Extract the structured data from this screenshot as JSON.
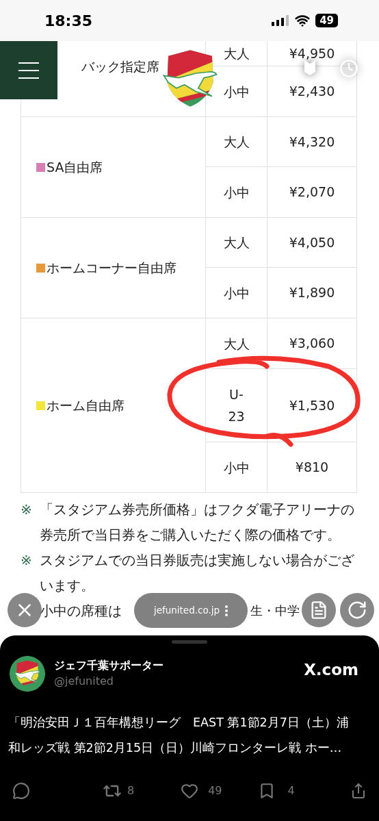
{
  "status_bar": {
    "time": "18:35",
    "battery": "49"
  },
  "price_table": {
    "sections": [
      {
        "label": "バック指定席",
        "rows": [
          {
            "type": "大人",
            "price": "¥4,950"
          },
          {
            "type": "小中",
            "price": "¥2,430"
          }
        ]
      },
      {
        "label": "SA自由席",
        "color": "#d77fb4",
        "rows": [
          {
            "type": "大人",
            "price": "¥4,320"
          },
          {
            "type": "小中",
            "price": "¥2,070"
          }
        ]
      },
      {
        "label": "ホームコーナー自由席",
        "color": "#e89a3a",
        "rows": [
          {
            "type": "大人",
            "price": "¥4,050"
          },
          {
            "type": "小中",
            "price": "¥1,890"
          }
        ]
      },
      {
        "label": "ホーム自由席",
        "color": "#f2e63c",
        "rows": [
          {
            "type": "大人",
            "price": "¥3,060"
          },
          {
            "type": "U-23",
            "price": "¥1,530"
          },
          {
            "type": "小中",
            "price": "¥810"
          }
        ]
      }
    ]
  },
  "notes": [
    {
      "mark": "※",
      "text": "「スタジアム券売所価格」はフクダ電子アリーナの券売所で当日券をご購入いただく際の価格です。"
    },
    {
      "mark": "※",
      "text": "スタジアムでの当日券販売は実施しない場合がございます。"
    },
    {
      "parts": [
        "小中の席種は",
        "生・中学"
      ]
    }
  ],
  "browser_bar": {
    "url": "jefunited.co.jp"
  },
  "post": {
    "author": "ジェフ千葉サポーター",
    "handle": "@jefunited",
    "source": "X.com",
    "text_lines": [
      "「明治安田Ｊ１百年構想リーグ　EAST 第1節2月7日（土）浦",
      "和レッズ戦 第2節2月15日（日）川崎フロンターレ戦 ホー…"
    ],
    "retweets": "8",
    "likes": "49",
    "bookmarks": "4"
  }
}
